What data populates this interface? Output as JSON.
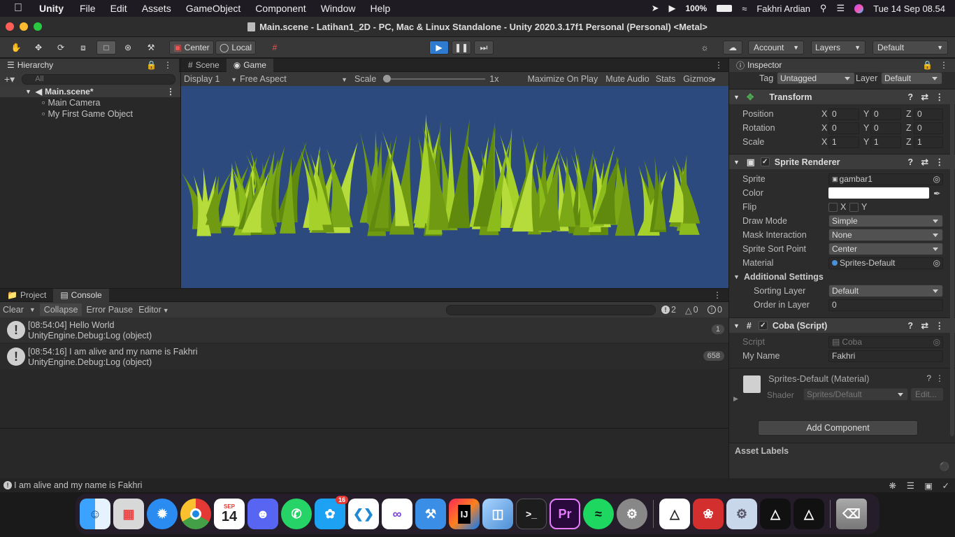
{
  "menubar": {
    "app": "Unity",
    "items": [
      "File",
      "Edit",
      "Assets",
      "GameObject",
      "Component",
      "Window",
      "Help"
    ],
    "battery": "100%",
    "user": "Fakhri Ardian",
    "datetime": "Tue 14 Sep  08.54"
  },
  "window": {
    "title": "Main.scene - Latihan1_2D - PC, Mac & Linux Standalone - Unity 2020.3.17f1 Personal (Personal) <Metal>"
  },
  "toolbar": {
    "pivot": "Center",
    "space": "Local",
    "account": "Account",
    "layers": "Layers",
    "layout": "Default"
  },
  "hierarchy": {
    "tab": "Hierarchy",
    "search_placeholder": "All",
    "scene": "Main.scene*",
    "items": [
      "Main Camera",
      "My First Game Object"
    ]
  },
  "game": {
    "tabs": [
      "Scene",
      "Game"
    ],
    "display": "Display 1",
    "aspect": "Free Aspect",
    "scale_label": "Scale",
    "scale_value": "1x",
    "scale_slider_fraction": 0,
    "maximize": "Maximize On Play",
    "mute": "Mute Audio",
    "stats": "Stats",
    "gizmos": "Gizmos",
    "bg_color": "#2c4a7e"
  },
  "console": {
    "tabs": [
      "Project",
      "Console"
    ],
    "clear": "Clear",
    "collapse": "Collapse",
    "error_pause": "Error Pause",
    "editor": "Editor",
    "count_log": "2",
    "count_warn": "0",
    "count_error": "0",
    "entries": [
      {
        "line1": "[08:54:04] Hello World",
        "line2": "UnityEngine.Debug:Log (object)",
        "count": "1"
      },
      {
        "line1": "[08:54:16] I am alive and my name is Fakhri",
        "line2": "UnityEngine.Debug:Log (object)",
        "count": "658"
      }
    ],
    "status": "I am alive and my name is Fakhri"
  },
  "inspector": {
    "tab": "Inspector",
    "tag_label": "Tag",
    "tag": "Untagged",
    "layer_label": "Layer",
    "layer": "Default",
    "transform": {
      "title": "Transform",
      "position_label": "Position",
      "rotation_label": "Rotation",
      "scale_label": "Scale",
      "position": [
        "0",
        "0",
        "0"
      ],
      "rotation": [
        "0",
        "0",
        "0"
      ],
      "scale": [
        "1",
        "1",
        "1"
      ],
      "axes": [
        "X",
        "Y",
        "Z"
      ]
    },
    "sprite_renderer": {
      "title": "Sprite Renderer",
      "sprite_label": "Sprite",
      "sprite": "gambar1",
      "color_label": "Color",
      "flip_label": "Flip",
      "flip_x": "X",
      "flip_y": "Y",
      "draw_mode_label": "Draw Mode",
      "draw_mode": "Simple",
      "mask_label": "Mask Interaction",
      "mask": "None",
      "sort_point_label": "Sprite Sort Point",
      "sort_point": "Center",
      "material_label": "Material",
      "material": "Sprites-Default",
      "additional": "Additional Settings",
      "sorting_layer_label": "Sorting Layer",
      "sorting_layer": "Default",
      "order_label": "Order in Layer",
      "order": "0"
    },
    "script": {
      "title": "Coba (Script)",
      "script_label": "Script",
      "script": "Coba",
      "name_label": "My Name",
      "name": "Fakhri"
    },
    "material": {
      "title": "Sprites-Default (Material)",
      "shader_label": "Shader",
      "shader": "Sprites/Default",
      "edit": "Edit..."
    },
    "add_component": "Add Component",
    "asset_labels": "Asset Labels"
  },
  "dock": {
    "calendar_month": "SEP",
    "calendar_day": "14",
    "twitter_badge": "16",
    "apps": [
      "finder",
      "launchpad",
      "safari",
      "chrome",
      "calendar",
      "discord",
      "whatsapp",
      "twitter",
      "vscode",
      "visual-studio",
      "xcode",
      "intellij",
      "cube",
      "terminal",
      "premiere",
      "spotify",
      "system-preferences",
      "unity-hub",
      "acrobat",
      "settings",
      "unity",
      "unity-2",
      "trash"
    ]
  }
}
